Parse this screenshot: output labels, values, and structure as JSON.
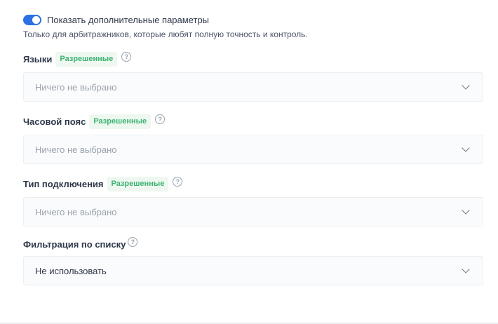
{
  "toggle": {
    "label": "Показать дополнительные параметры",
    "enabled": true,
    "accent": "#2f6fe4"
  },
  "hint": "Только для арбитражников, которые любят полную точность и контроль.",
  "fields": [
    {
      "label": "Языки",
      "badge": "Разрешенные",
      "help_icon": "question-circle",
      "value": "Ничего не выбрано",
      "placeholder": true
    },
    {
      "label": "Часовой пояс",
      "badge": "Разрешенные",
      "help_icon": "question-circle",
      "value": "Ничего не выбрано",
      "placeholder": true
    },
    {
      "label": "Тип подключения",
      "badge": "Разрешенные",
      "help_icon": "question-circle",
      "value": "Ничего не выбрано",
      "placeholder": true
    },
    {
      "label": "Фильтрация по списку",
      "help_icon": "question-circle",
      "value": "Не использовать",
      "placeholder": false
    }
  ],
  "colors": {
    "badge_text": "#3cb371",
    "badge_bg": "#eef8f1",
    "placeholder_text": "#9aa3ad"
  }
}
